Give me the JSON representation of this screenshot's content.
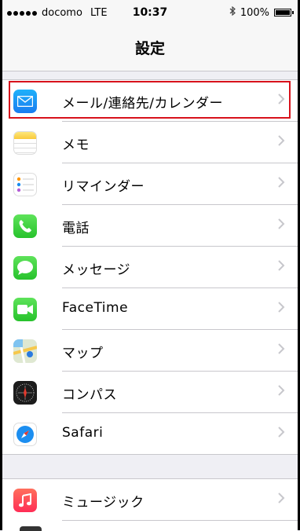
{
  "statusbar": {
    "carrier": "docomo",
    "network": "LTE",
    "time": "10:37",
    "battery": "100%"
  },
  "navbar": {
    "title": "設定"
  },
  "groups": [
    {
      "items": [
        {
          "label": "メール/連絡先/カレンダー",
          "icon": "mail-icon",
          "selected": true
        },
        {
          "label": "メモ",
          "icon": "notes-icon"
        },
        {
          "label": "リマインダー",
          "icon": "reminders-icon"
        },
        {
          "label": "電話",
          "icon": "phone-icon"
        },
        {
          "label": "メッセージ",
          "icon": "messages-icon"
        },
        {
          "label": "FaceTime",
          "icon": "facetime-icon"
        },
        {
          "label": "マップ",
          "icon": "maps-icon"
        },
        {
          "label": "コンパス",
          "icon": "compass-icon"
        },
        {
          "label": "Safari",
          "icon": "safari-icon"
        }
      ]
    },
    {
      "items": [
        {
          "label": "ミュージック",
          "icon": "music-icon"
        }
      ]
    }
  ],
  "colors": {
    "highlight": "#d8121c",
    "background": "#efeff4",
    "chevron": "#c7c7cc"
  }
}
